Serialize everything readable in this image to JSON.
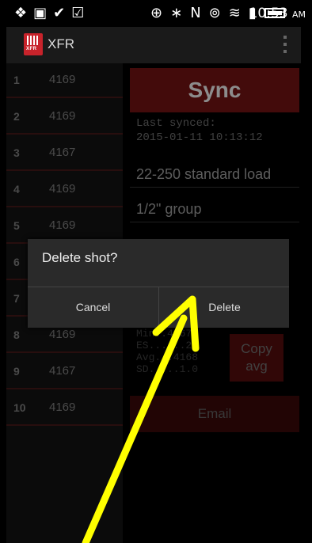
{
  "status_bar": {
    "left_icons": [
      "❖",
      "▣",
      "✔",
      "☑"
    ],
    "right_icons": [
      "⊕",
      "∗",
      "N",
      "⊚",
      "≋",
      "▮"
    ],
    "time": "10:53",
    "ampm": "AM"
  },
  "app": {
    "logo_text": "XFR",
    "title": "XFR"
  },
  "shots": [
    {
      "num": "1",
      "value": "4169"
    },
    {
      "num": "2",
      "value": "4169"
    },
    {
      "num": "3",
      "value": "4167"
    },
    {
      "num": "4",
      "value": "4169"
    },
    {
      "num": "5",
      "value": "4169"
    },
    {
      "num": "6",
      "value": ""
    },
    {
      "num": "7",
      "value": ""
    },
    {
      "num": "8",
      "value": "4169"
    },
    {
      "num": "9",
      "value": "4167"
    },
    {
      "num": "10",
      "value": "4169"
    }
  ],
  "panel": {
    "sync_label": "Sync",
    "last_synced_label": "Last synced:",
    "last_synced_value": "2015-01-11 10:13:12",
    "load_name": "22-250 standard load",
    "group_name": "1/2\" group",
    "stats": [
      "Min..4167",
      "ES......2",
      "Avg...4168",
      "SD.....1.0"
    ],
    "copy_avg_label": "Copy avg",
    "email_label": "Email"
  },
  "dialog": {
    "title": "Delete shot?",
    "cancel_label": "Cancel",
    "delete_label": "Delete"
  },
  "colors": {
    "accent_red": "#7a1414",
    "arrow_yellow": "#ffff00"
  }
}
